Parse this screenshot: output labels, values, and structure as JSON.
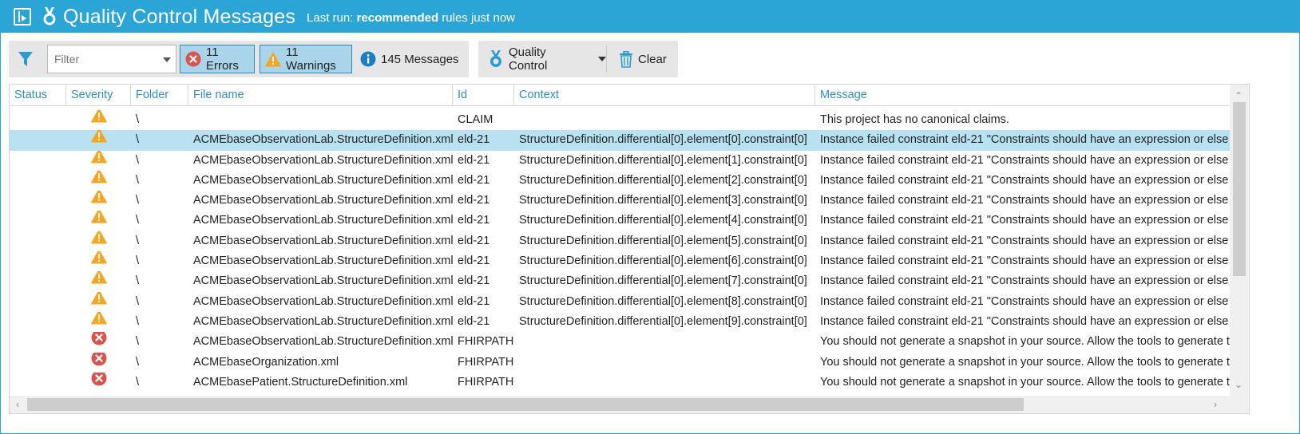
{
  "title_bar": {
    "title": "Quality Control Messages",
    "last_run_prefix": "Last run: ",
    "last_run_bold": "recommended",
    "last_run_suffix": " rules just now"
  },
  "toolbar": {
    "filter_placeholder": "Filter",
    "errors_label": "11 Errors",
    "warnings_label": "11 Warnings",
    "messages_label": "145 Messages",
    "quality_control_label": "Quality Control",
    "clear_label": "Clear"
  },
  "columns": [
    "Status",
    "Severity",
    "Folder",
    "File name",
    "Id",
    "Context",
    "Message"
  ],
  "rows": [
    {
      "status": "",
      "severity": "warning",
      "folder": "\\",
      "file": "",
      "id": "CLAIM",
      "context": "",
      "message": "This project has no canonical claims."
    },
    {
      "status": "",
      "severity": "warning",
      "folder": "\\",
      "file": "ACMEbaseObservationLab.StructureDefinition.xml",
      "id": "eld-21",
      "context": "StructureDefinition.differential[0].element[0].constraint[0]",
      "message": "Instance failed constraint eld-21 \"Constraints should have an expression or else v"
    },
    {
      "status": "",
      "severity": "warning",
      "folder": "\\",
      "file": "ACMEbaseObservationLab.StructureDefinition.xml",
      "id": "eld-21",
      "context": "StructureDefinition.differential[0].element[1].constraint[0]",
      "message": "Instance failed constraint eld-21 \"Constraints should have an expression or else v"
    },
    {
      "status": "",
      "severity": "warning",
      "folder": "\\",
      "file": "ACMEbaseObservationLab.StructureDefinition.xml",
      "id": "eld-21",
      "context": "StructureDefinition.differential[0].element[2].constraint[0]",
      "message": "Instance failed constraint eld-21 \"Constraints should have an expression or else v"
    },
    {
      "status": "",
      "severity": "warning",
      "folder": "\\",
      "file": "ACMEbaseObservationLab.StructureDefinition.xml",
      "id": "eld-21",
      "context": "StructureDefinition.differential[0].element[3].constraint[0]",
      "message": "Instance failed constraint eld-21 \"Constraints should have an expression or else v"
    },
    {
      "status": "",
      "severity": "warning",
      "folder": "\\",
      "file": "ACMEbaseObservationLab.StructureDefinition.xml",
      "id": "eld-21",
      "context": "StructureDefinition.differential[0].element[4].constraint[0]",
      "message": "Instance failed constraint eld-21 \"Constraints should have an expression or else v"
    },
    {
      "status": "",
      "severity": "warning",
      "folder": "\\",
      "file": "ACMEbaseObservationLab.StructureDefinition.xml",
      "id": "eld-21",
      "context": "StructureDefinition.differential[0].element[5].constraint[0]",
      "message": "Instance failed constraint eld-21 \"Constraints should have an expression or else v"
    },
    {
      "status": "",
      "severity": "warning",
      "folder": "\\",
      "file": "ACMEbaseObservationLab.StructureDefinition.xml",
      "id": "eld-21",
      "context": "StructureDefinition.differential[0].element[6].constraint[0]",
      "message": "Instance failed constraint eld-21 \"Constraints should have an expression or else v"
    },
    {
      "status": "",
      "severity": "warning",
      "folder": "\\",
      "file": "ACMEbaseObservationLab.StructureDefinition.xml",
      "id": "eld-21",
      "context": "StructureDefinition.differential[0].element[7].constraint[0]",
      "message": "Instance failed constraint eld-21 \"Constraints should have an expression or else v"
    },
    {
      "status": "",
      "severity": "warning",
      "folder": "\\",
      "file": "ACMEbaseObservationLab.StructureDefinition.xml",
      "id": "eld-21",
      "context": "StructureDefinition.differential[0].element[8].constraint[0]",
      "message": "Instance failed constraint eld-21 \"Constraints should have an expression or else v"
    },
    {
      "status": "",
      "severity": "warning",
      "folder": "\\",
      "file": "ACMEbaseObservationLab.StructureDefinition.xml",
      "id": "eld-21",
      "context": "StructureDefinition.differential[0].element[9].constraint[0]",
      "message": "Instance failed constraint eld-21 \"Constraints should have an expression or else v"
    },
    {
      "status": "",
      "severity": "error",
      "folder": "\\",
      "file": "ACMEbaseObservationLab.StructureDefinition.xml",
      "id": "FHIRPATH",
      "context": "",
      "message": "You should not generate a snapshot in your source. Allow the tools to generate t"
    },
    {
      "status": "",
      "severity": "error",
      "folder": "\\",
      "file": "ACMEbaseOrganization.xml",
      "id": "FHIRPATH",
      "context": "",
      "message": "You should not generate a snapshot in your source. Allow the tools to generate t"
    },
    {
      "status": "",
      "severity": "error",
      "folder": "\\",
      "file": "ACMEbasePatient.StructureDefinition.xml",
      "id": "FHIRPATH",
      "context": "",
      "message": "You should not generate a snapshot in your source. Allow the tools to generate t"
    }
  ],
  "selected_row_index": 1,
  "colors": {
    "accent": "#2aa5d6",
    "header_text": "#2d8fc4",
    "selected_row": "#b8e2f2",
    "warning": "#f5a623",
    "error": "#d9534f",
    "info": "#1e7fc0"
  }
}
